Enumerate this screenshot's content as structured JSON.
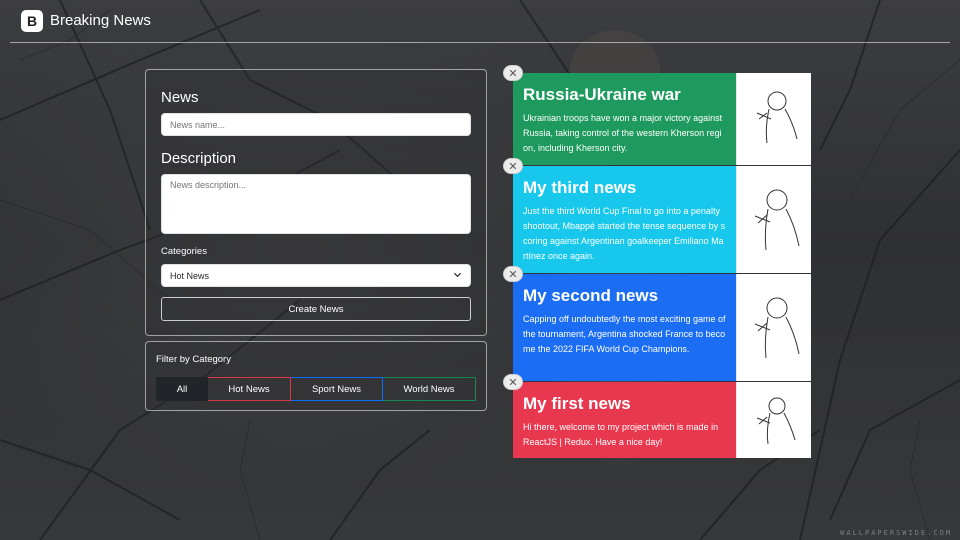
{
  "navbar": {
    "brand_logo": "B",
    "brand_title": "Breaking News"
  },
  "form": {
    "news_label": "News",
    "news_placeholder": "News name...",
    "description_label": "Description",
    "description_placeholder": "News description...",
    "categories_label": "Categories",
    "category_selected": "Hot News",
    "create_button": "Create News"
  },
  "filter": {
    "title": "Filter by Category",
    "buttons": [
      {
        "label": "All",
        "active": true,
        "color": "#212529"
      },
      {
        "label": "Hot News",
        "color": "#dc3545"
      },
      {
        "label": "Sport News",
        "color": "#0d6efd"
      },
      {
        "label": "World News",
        "color": "#198754"
      }
    ]
  },
  "news": [
    {
      "title": "Russia-Ukraine war",
      "description": "Ukrainian troops have won a major victory against Russia, taking control of the western Kherson region, including Kherson city.",
      "color": "#1f9a5e",
      "close": "✕"
    },
    {
      "title": "My third news",
      "description": "Just the third World Cup Final to go into a penalty shootout, Mbappé started the tense sequence by scoring against Argentinan goalkeeper Emiliano Martínez once again.",
      "color": "#18c8ec",
      "close": "✕"
    },
    {
      "title": "My second news",
      "description": "Capping off undoubtedly the most exciting game of the tournament, Argentina shocked France to become the 2022 FIFA World Cup Champions.",
      "color": "#1b6ef3",
      "close": "✕"
    },
    {
      "title": "My first news",
      "description": "Hi there, welcome to my project which is made in ReactJS | Redux. Have a nice day!",
      "color": "#e8384f",
      "close": "✕"
    }
  ],
  "watermark": "WALLPAPERSWIDE.COM"
}
